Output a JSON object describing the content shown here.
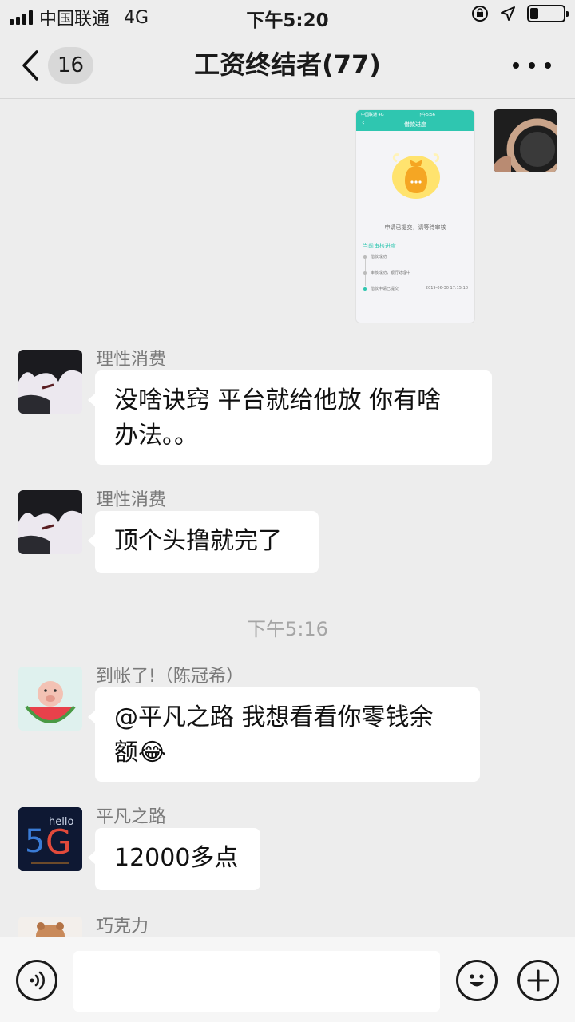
{
  "status_bar": {
    "carrier": "中国联通",
    "network": "4G",
    "time": "下午5:20",
    "battery_percent": 25
  },
  "header": {
    "unread_count": "16",
    "title": "工资终结者(77)"
  },
  "screenshot_image": {
    "status_left": "中国联通 4G",
    "status_time": "下午5:56",
    "page_title": "借款进度",
    "notice": "申请已提交，请等待审核",
    "progress_title": "当前审核进度",
    "steps": [
      {
        "label": "借款成功",
        "time": ""
      },
      {
        "label": "审核成功，银行处理中",
        "time": ""
      },
      {
        "label": "借款申请已提交",
        "time": "2019-06-30 17:15:10"
      }
    ]
  },
  "messages": [
    {
      "sender": "理性消费",
      "text_line1": "没啥诀窍 平台就给他放 你有啥",
      "text_line2": "办法。。"
    },
    {
      "sender": "理性消费",
      "text": "顶个头撸就完了"
    },
    {
      "sender": "到帐了!（陈冠希）",
      "text_line1": "@平凡之路 我想看看你零钱余",
      "text_line2": "额😂"
    },
    {
      "sender": "平凡之路",
      "text": "12000多点"
    },
    {
      "sender": "巧克力"
    }
  ],
  "timestamp": "下午5:16",
  "input": {
    "value": ""
  },
  "colors": {
    "accent": "#2fc6b0",
    "background": "#ededed",
    "bubble": "#ffffff"
  }
}
